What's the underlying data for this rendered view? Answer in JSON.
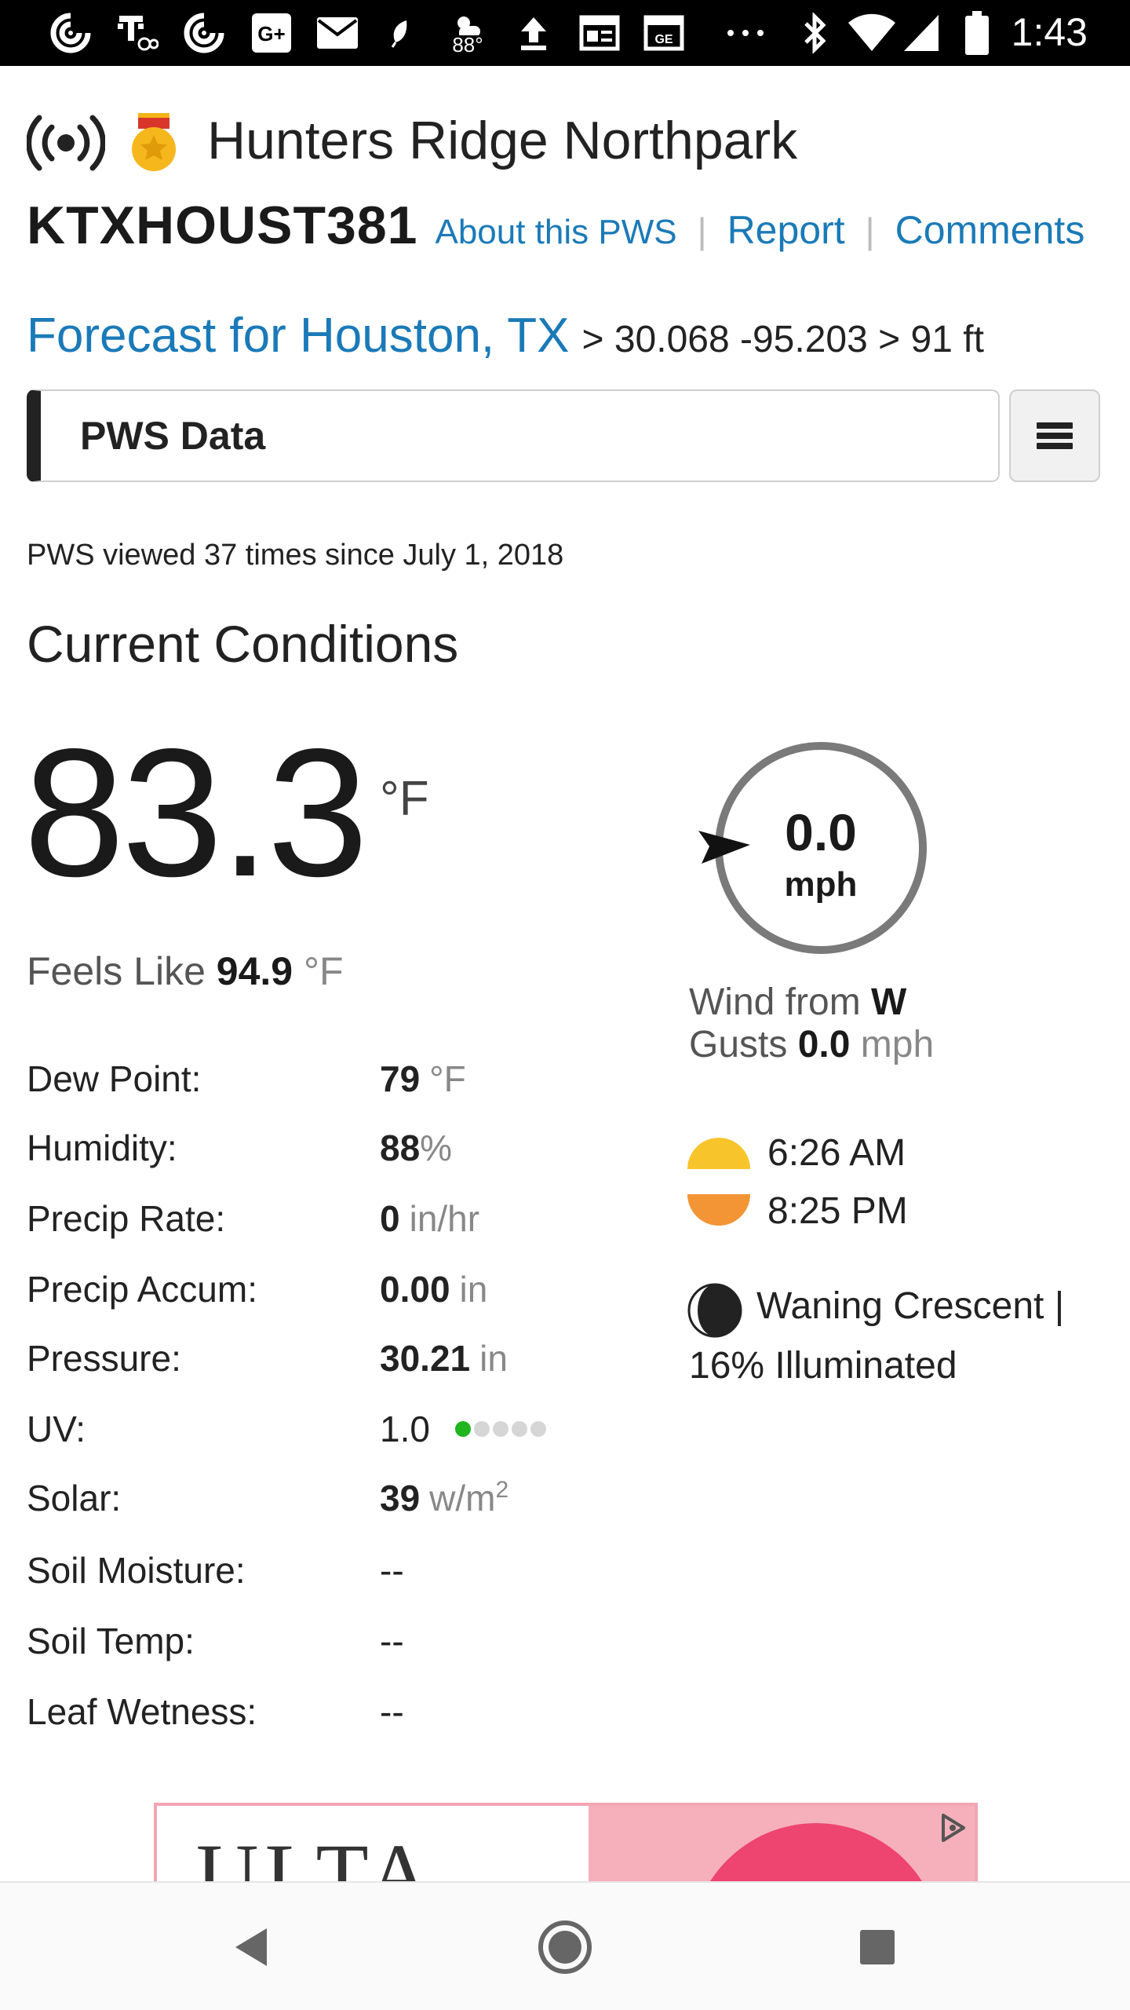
{
  "status_bar": {
    "time": "1:43",
    "weather_temp": "88°",
    "icons": [
      "browser-swirl-icon",
      "tmobile-voicemail-icon",
      "browser-swirl-icon",
      "google-plus-icon",
      "mail-icon",
      "leaf-icon",
      "weather-icon",
      "upload-icon",
      "news-icon",
      "news-icon",
      "more-icon",
      "bluetooth-icon",
      "wifi-icon",
      "signal-icon",
      "battery-icon"
    ]
  },
  "station": {
    "name": "Hunters Ridge Northpark",
    "id": "KTXHOUST381",
    "links": {
      "about": "About this PWS",
      "report": "Report",
      "comments": "Comments"
    },
    "separator": "|",
    "icons": [
      "broadcast-icon",
      "medal-icon"
    ]
  },
  "forecast": {
    "link": "Forecast for Houston, TX",
    "coords": "> 30.068 -95.203 > 91 ft"
  },
  "pws_bar": {
    "label": "PWS Data",
    "menu_icon": "hamburger-menu-icon"
  },
  "viewed_text": "PWS viewed 37 times since July 1, 2018",
  "current": {
    "title": "Current Conditions",
    "temp": "83.3",
    "temp_unit": "°F",
    "feels_like_label": "Feels Like",
    "feels_like_value": "94.9",
    "feels_like_unit": "°F"
  },
  "conditions": [
    {
      "label": "Dew Point:",
      "value": "79",
      "unit": "°F"
    },
    {
      "label": "Humidity:",
      "value": "88",
      "unit": "%"
    },
    {
      "label": "Precip Rate:",
      "value": "0",
      "unit": "in/hr"
    },
    {
      "label": "Precip Accum:",
      "value": "0.00",
      "unit": "in"
    },
    {
      "label": "Pressure:",
      "value": "30.21",
      "unit": "in"
    },
    {
      "label": "UV:",
      "value": "1.0",
      "unit": ""
    },
    {
      "label": "Solar:",
      "value": "39",
      "unit": "w/m",
      "unit_sup": "2"
    },
    {
      "label": "Soil Moisture:",
      "value": "--",
      "unit": ""
    },
    {
      "label": "Soil Temp:",
      "value": "--",
      "unit": ""
    },
    {
      "label": "Leaf Wetness:",
      "value": "--",
      "unit": ""
    }
  ],
  "uv_scale": {
    "level": 1,
    "max": 5,
    "on_color": "#1fb51f",
    "off_color": "#d6d6d6"
  },
  "wind": {
    "speed": "0.0",
    "speed_unit": "mph",
    "from_label": "Wind from",
    "direction": "W",
    "gusts_label": "Gusts",
    "gusts_value": "0.0",
    "gusts_unit": "mph"
  },
  "sun": {
    "sunrise": "6:26 AM",
    "sunset": "8:25 PM",
    "sunrise_color": "#f7c52b",
    "sunset_color": "#f39534"
  },
  "moon": {
    "phase_line1": "Waning Crescent |",
    "phase_line2": "16% Illuminated"
  },
  "ad": {
    "brand": "ULTA",
    "choice_icon": "ad-choices-icon"
  },
  "nav_bar": {
    "icons": [
      "back-icon",
      "home-icon",
      "recents-icon"
    ]
  }
}
